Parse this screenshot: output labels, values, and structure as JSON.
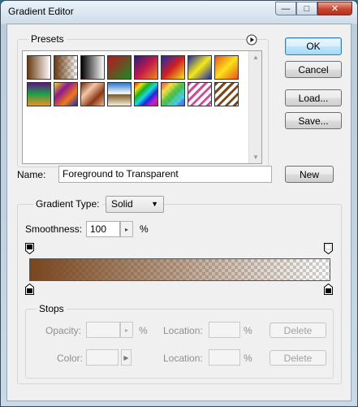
{
  "window": {
    "title": "Gradient Editor",
    "minimize_glyph": "—",
    "maximize_glyph": "□",
    "close_glyph": "✕"
  },
  "presets": {
    "label": "Presets",
    "menu_icon": "play-circle-icon",
    "swatches": [
      {
        "name": "foreground-to-background",
        "bg": "linear-gradient(to right,#6b3a12,#ffffff)"
      },
      {
        "name": "foreground-to-transparent",
        "bg": "linear-gradient(to right,#6b3a12,rgba(107,58,18,0)),repeating-conic-gradient(#cfcfcf 0 25%,#fff 0 50%) 0 0/8px 8px"
      },
      {
        "name": "black-white",
        "bg": "linear-gradient(to right,#000,#fff)"
      },
      {
        "name": "red-green",
        "bg": "linear-gradient(135deg,#c0121e,#1a8a2a)"
      },
      {
        "name": "violet-orange",
        "bg": "linear-gradient(135deg,#2b1a7e,#c01a4a,#f08a18)"
      },
      {
        "name": "blue-red-yellow",
        "bg": "linear-gradient(135deg,#1a2bb0,#d01e22,#f6e61a)"
      },
      {
        "name": "blue-yellow-blue",
        "bg": "linear-gradient(135deg,#1c2aa8,#f5e81a,#1c2aa8)"
      },
      {
        "name": "orange-yellow-orange",
        "bg": "linear-gradient(135deg,#e7561a,#fbe11a,#e7561a)"
      },
      {
        "name": "violet-green-orange",
        "bg": "linear-gradient(to bottom,#5a1a7c,#21a04a,#f18f1b)"
      },
      {
        "name": "yellow-violet-orange-blue",
        "bg": "linear-gradient(135deg,#f4d41a,#8a1a8e,#f0781a,#1a2ea8)"
      },
      {
        "name": "copper",
        "bg": "linear-gradient(135deg,#6a2a0c,#f3c7a8,#8a3a12,#f0b08a)"
      },
      {
        "name": "chrome",
        "bg": "linear-gradient(to bottom,#2a78c8,#ffffff 48%,#7a5a2a 52%,#f6f0d8)"
      },
      {
        "name": "spectrum",
        "bg": "linear-gradient(135deg,#e01a1a,#f7e01a,#1ab01a,#1ad8e0,#1a2ad8,#c81ad8,#e01a1a)"
      },
      {
        "name": "transparent-rainbow",
        "bg": "linear-gradient(135deg,rgba(230,30,30,.8),rgba(250,220,30,.8),rgba(30,180,30,.8),rgba(30,200,220,.8),rgba(40,40,220,.8)),repeating-conic-gradient(#cfcfcf 0 25%,#fff 0 50%) 0 0/8px 8px"
      },
      {
        "name": "transparent-stripes",
        "bg": "repeating-linear-gradient(135deg,#d64a9a 0 3px,#ffffff 3px 7px)"
      },
      {
        "name": "brown-stripes",
        "bg": "repeating-linear-gradient(135deg,#7a4a1e 0 3px,#ffffff 3px 7px)"
      }
    ]
  },
  "buttons": {
    "ok": "OK",
    "cancel": "Cancel",
    "load": "Load...",
    "save": "Save...",
    "new": "New"
  },
  "name_field": {
    "label": "Name:",
    "value": "Foreground to Transparent"
  },
  "gradient": {
    "type_label": "Gradient Type:",
    "type_value": "Solid",
    "smoothness_label": "Smoothness:",
    "smoothness_value": "100",
    "smoothness_unit": "%",
    "color": "#784620"
  },
  "stops": {
    "label": "Stops",
    "opacity_label": "Opacity:",
    "opacity_unit": "%",
    "color_label": "Color:",
    "location_label": "Location:",
    "location_unit": "%",
    "delete_label": "Delete"
  }
}
